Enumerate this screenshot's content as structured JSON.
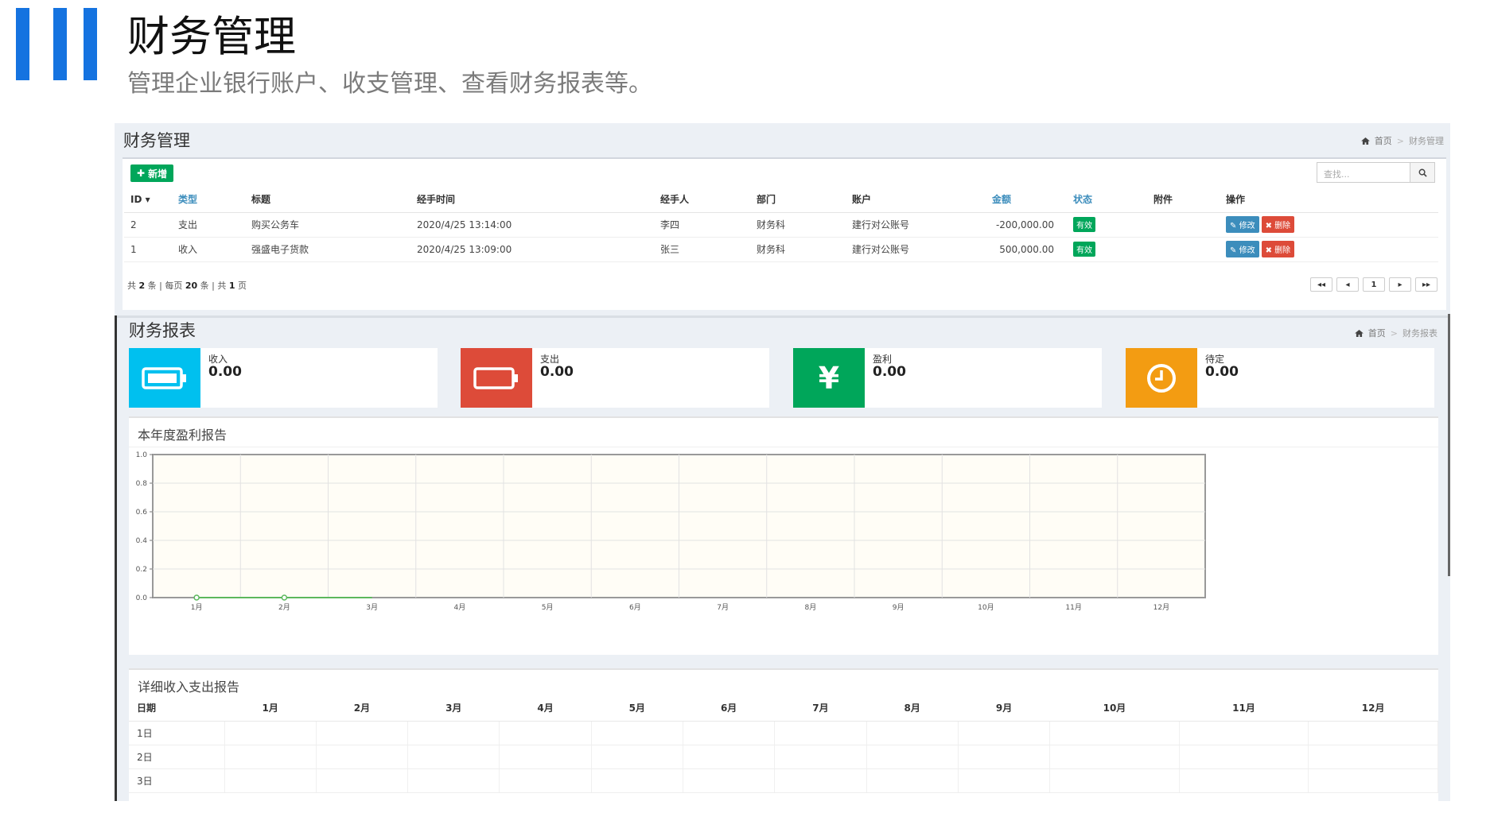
{
  "slide": {
    "title": "财务管理",
    "subtitle": "管理企业银行账户、收支管理、查看财务报表等。"
  },
  "management": {
    "title": "财务管理",
    "breadcrumb": {
      "home": "首页",
      "current": "财务管理"
    },
    "add_label": "新增",
    "search_placeholder": "查找...",
    "columns": [
      "ID",
      "类型",
      "标题",
      "经手时间",
      "经手人",
      "部门",
      "账户",
      "金额",
      "状态",
      "附件",
      "操作"
    ],
    "rows": [
      {
        "id": "2",
        "type": "支出",
        "title": "购买公务车",
        "time": "2020/4/25 13:14:00",
        "handler": "李四",
        "dept": "财务科",
        "account": "建行对公账号",
        "amount": "-200,000.00",
        "status": "有效",
        "attachment": ""
      },
      {
        "id": "1",
        "type": "收入",
        "title": "强盛电子货款",
        "time": "2020/4/25 13:09:00",
        "handler": "张三",
        "dept": "财务科",
        "account": "建行对公账号",
        "amount": "500,000.00",
        "status": "有效",
        "attachment": ""
      }
    ],
    "edit_label": "修改",
    "delete_label": "删除",
    "pager": {
      "p1": "共",
      "total": "2",
      "p2": "条 | 每页",
      "per_page": "20",
      "p3": "条 | 共",
      "pages": "1",
      "p4": "页",
      "current_page": "1"
    }
  },
  "report": {
    "title": "财务报表",
    "breadcrumb": {
      "home": "首页",
      "current": "财务报表"
    },
    "cards": [
      {
        "label": "收入",
        "value": "0.00",
        "color": "#00c0ef",
        "icon": "battery-full-icon"
      },
      {
        "label": "支出",
        "value": "0.00",
        "color": "#dd4b39",
        "icon": "battery-empty-icon"
      },
      {
        "label": "盈利",
        "value": "0.00",
        "color": "#00a65a",
        "icon": "yen-icon"
      },
      {
        "label": "待定",
        "value": "0.00",
        "color": "#f39c12",
        "icon": "clock-icon"
      }
    ],
    "chart_title": "本年度盈利报告",
    "table_title": "详细收入支出报告",
    "table_columns": [
      "日期",
      "1月",
      "2月",
      "3月",
      "4月",
      "5月",
      "6月",
      "7月",
      "8月",
      "9月",
      "10月",
      "11月",
      "12月"
    ],
    "table_rows": [
      "1日",
      "2日",
      "3日"
    ]
  },
  "chart_data": {
    "type": "line",
    "categories": [
      "1月",
      "2月",
      "3月",
      "4月",
      "5月",
      "6月",
      "7月",
      "8月",
      "9月",
      "10月",
      "11月",
      "12月"
    ],
    "ylim": [
      0,
      1.0
    ],
    "yticks": [
      "0.0",
      "0.2",
      "0.4",
      "0.6",
      "0.8",
      "1.0"
    ],
    "series": [
      {
        "values": [
          0,
          0,
          0
        ],
        "color": "#5cb85c"
      }
    ],
    "grid": true,
    "plot_bg": "#fffdf6"
  }
}
